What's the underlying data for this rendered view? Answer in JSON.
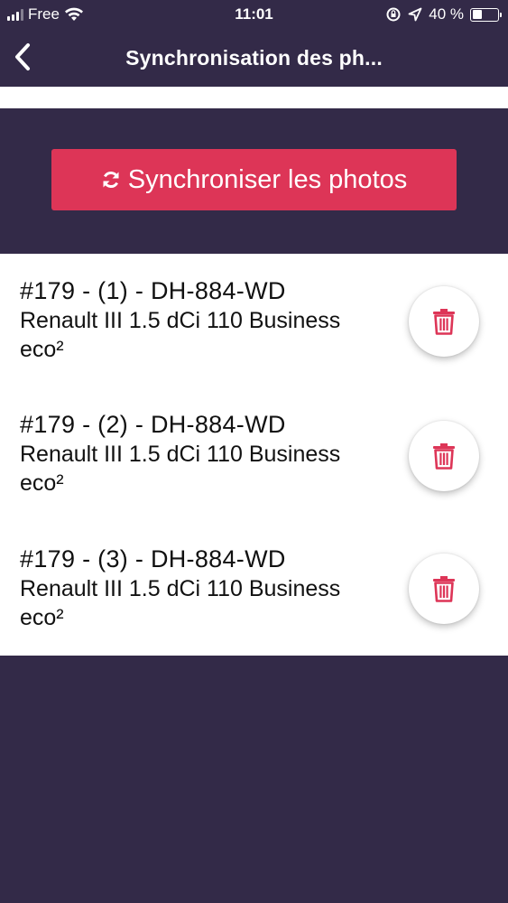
{
  "status_bar": {
    "carrier": "Free",
    "time": "11:01",
    "battery": "40 %",
    "battery_level": 0.4
  },
  "nav": {
    "title": "Synchronisation des ph..."
  },
  "sync": {
    "button_label": "Synchroniser les photos"
  },
  "items": [
    {
      "title": "#179 - (1) - DH-884-WD",
      "description": "Renault III 1.5 dCi 110 Business eco²"
    },
    {
      "title": "#179 - (2) - DH-884-WD",
      "description": "Renault III 1.5 dCi 110 Business eco²"
    },
    {
      "title": "#179 - (3) - DH-884-WD",
      "description": "Renault III 1.5 dCi 110 Business eco²"
    }
  ],
  "colors": {
    "header_bg": "#332a48",
    "accent": "#dd3557"
  }
}
